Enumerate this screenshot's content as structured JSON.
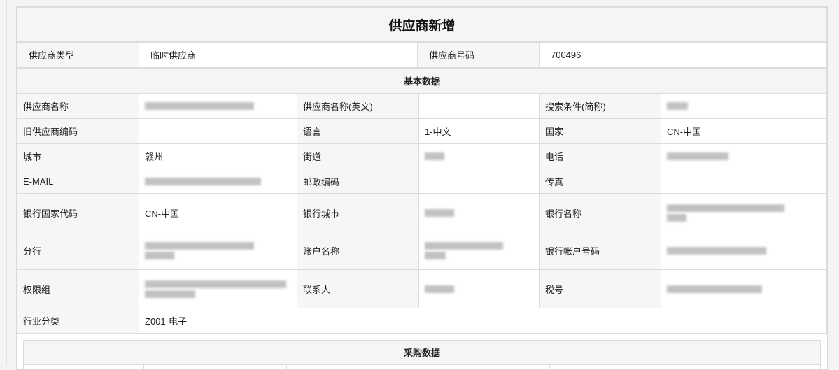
{
  "title": "供应商新增",
  "header": {
    "type_label": "供应商类型",
    "type_value": "临时供应商",
    "code_label": "供应商号码",
    "code_value": "700496"
  },
  "basic": {
    "section_title": "基本数据",
    "name_label": "供应商名称",
    "name_en_label": "供应商名称(英文)",
    "search_label": "搜索条件(简称)",
    "old_code_label": "旧供应商编码",
    "language_label": "语言",
    "language_value": "1-中文",
    "country_label": "国家",
    "country_value": "CN-中国",
    "city_label": "城市",
    "city_value": "赣州",
    "street_label": "街道",
    "phone_label": "电话",
    "email_label": "E-MAIL",
    "postal_label": "邮政编码",
    "fax_label": "传真",
    "bank_country_label": "银行国家代码",
    "bank_country_value": "CN-中国",
    "bank_city_label": "银行城市",
    "bank_name_label": "银行名称",
    "branch_label": "分行",
    "account_name_label": "账户名称",
    "account_no_label": "银行帐户号码",
    "auth_group_label": "权限组",
    "contact_label": "联系人",
    "tax_label": "税号",
    "industry_label": "行业分类",
    "industry_value": "Z001-电子"
  },
  "purchase": {
    "section_title": "采购数据"
  }
}
